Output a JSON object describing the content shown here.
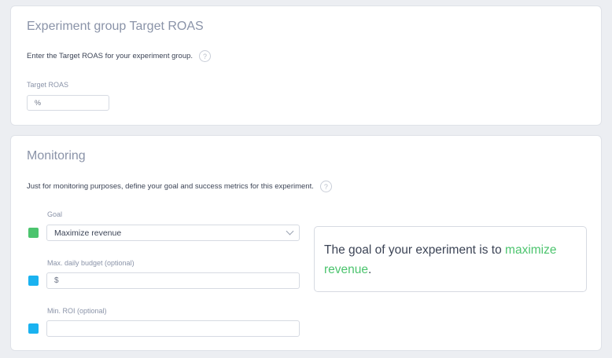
{
  "roas_section": {
    "title": "Experiment group Target ROAS",
    "description": "Enter the Target ROAS for your experiment group.",
    "help_glyph": "?",
    "field_label": "Target ROAS",
    "field_prefix": "%",
    "field_value": ""
  },
  "monitoring_section": {
    "title": "Monitoring",
    "description": "Just for monitoring purposes, define your goal and success metrics for this experiment.",
    "help_glyph": "?",
    "goal": {
      "label": "Goal",
      "selected": "Maximize revenue",
      "marker_color": "#4cc46e"
    },
    "budget": {
      "label": "Max. daily budget (optional)",
      "prefix": "$",
      "value": "",
      "marker_color": "#1ab2f0"
    },
    "roi": {
      "label": "Min. ROI (optional)",
      "value": "",
      "marker_color": "#1ab2f0"
    },
    "summary": {
      "prefix": "The goal of your experiment is to ",
      "highlight": "maximize revenue",
      "suffix": "."
    }
  },
  "colors": {
    "accent_green": "#4cc46e",
    "accent_blue": "#1ab2f0"
  }
}
